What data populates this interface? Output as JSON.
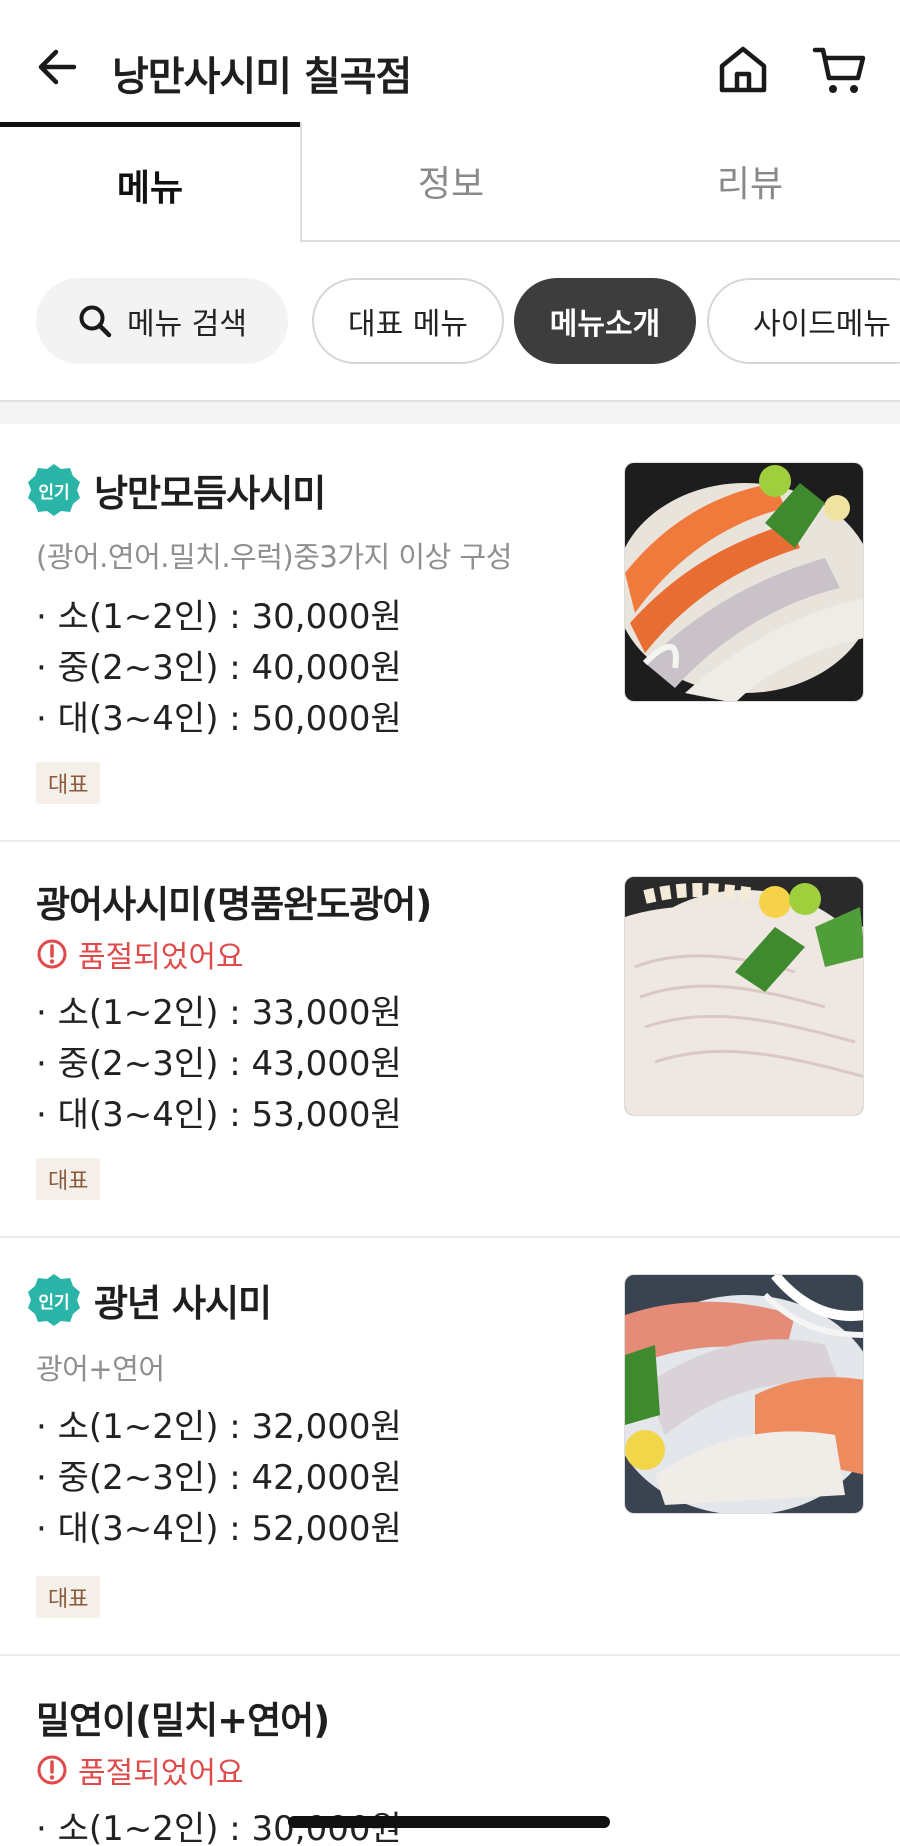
{
  "header": {
    "store_title": "낭만사시미 칠곡점"
  },
  "tabs": [
    {
      "label": "메뉴"
    },
    {
      "label": "정보"
    },
    {
      "label": "리뷰"
    }
  ],
  "chips": {
    "search_label": "메뉴 검색",
    "items": [
      {
        "label": "대표 메뉴"
      },
      {
        "label": "메뉴소개"
      },
      {
        "label": "사이드메뉴"
      }
    ]
  },
  "badges": {
    "popular": "인기",
    "representative": "대표",
    "sold_out": "품절되었어요"
  },
  "menu_items": [
    {
      "name": "낭만모듬사시미",
      "description": "(광어.연어.밀치.우럭)중3가지 이상 구성",
      "prices": [
        "· 소(1~2인) : 30,000원",
        "· 중(2~3인) : 40,000원",
        "· 대(3~4인) : 50,000원"
      ]
    },
    {
      "name": "광어사시미(명품완도광어)",
      "prices": [
        "· 소(1~2인) : 33,000원",
        "· 중(2~3인) : 43,000원",
        "· 대(3~4인) : 53,000원"
      ]
    },
    {
      "name": "광년 사시미",
      "description": "광어+연어",
      "prices": [
        "· 소(1~2인) : 32,000원",
        "· 중(2~3인) : 42,000원",
        "· 대(3~4인) : 52,000원"
      ]
    },
    {
      "name": "밀연이(밀치+연어)",
      "prices": [
        "· 소(1~2인) : 30,000원"
      ]
    }
  ],
  "colors": {
    "active_chip": "#3d3d3d",
    "popular_badge": "#2bb5a8",
    "sold_out": "#e04a4a",
    "tag_bg": "#f5efe9",
    "tag_text": "#8b5a3c"
  }
}
